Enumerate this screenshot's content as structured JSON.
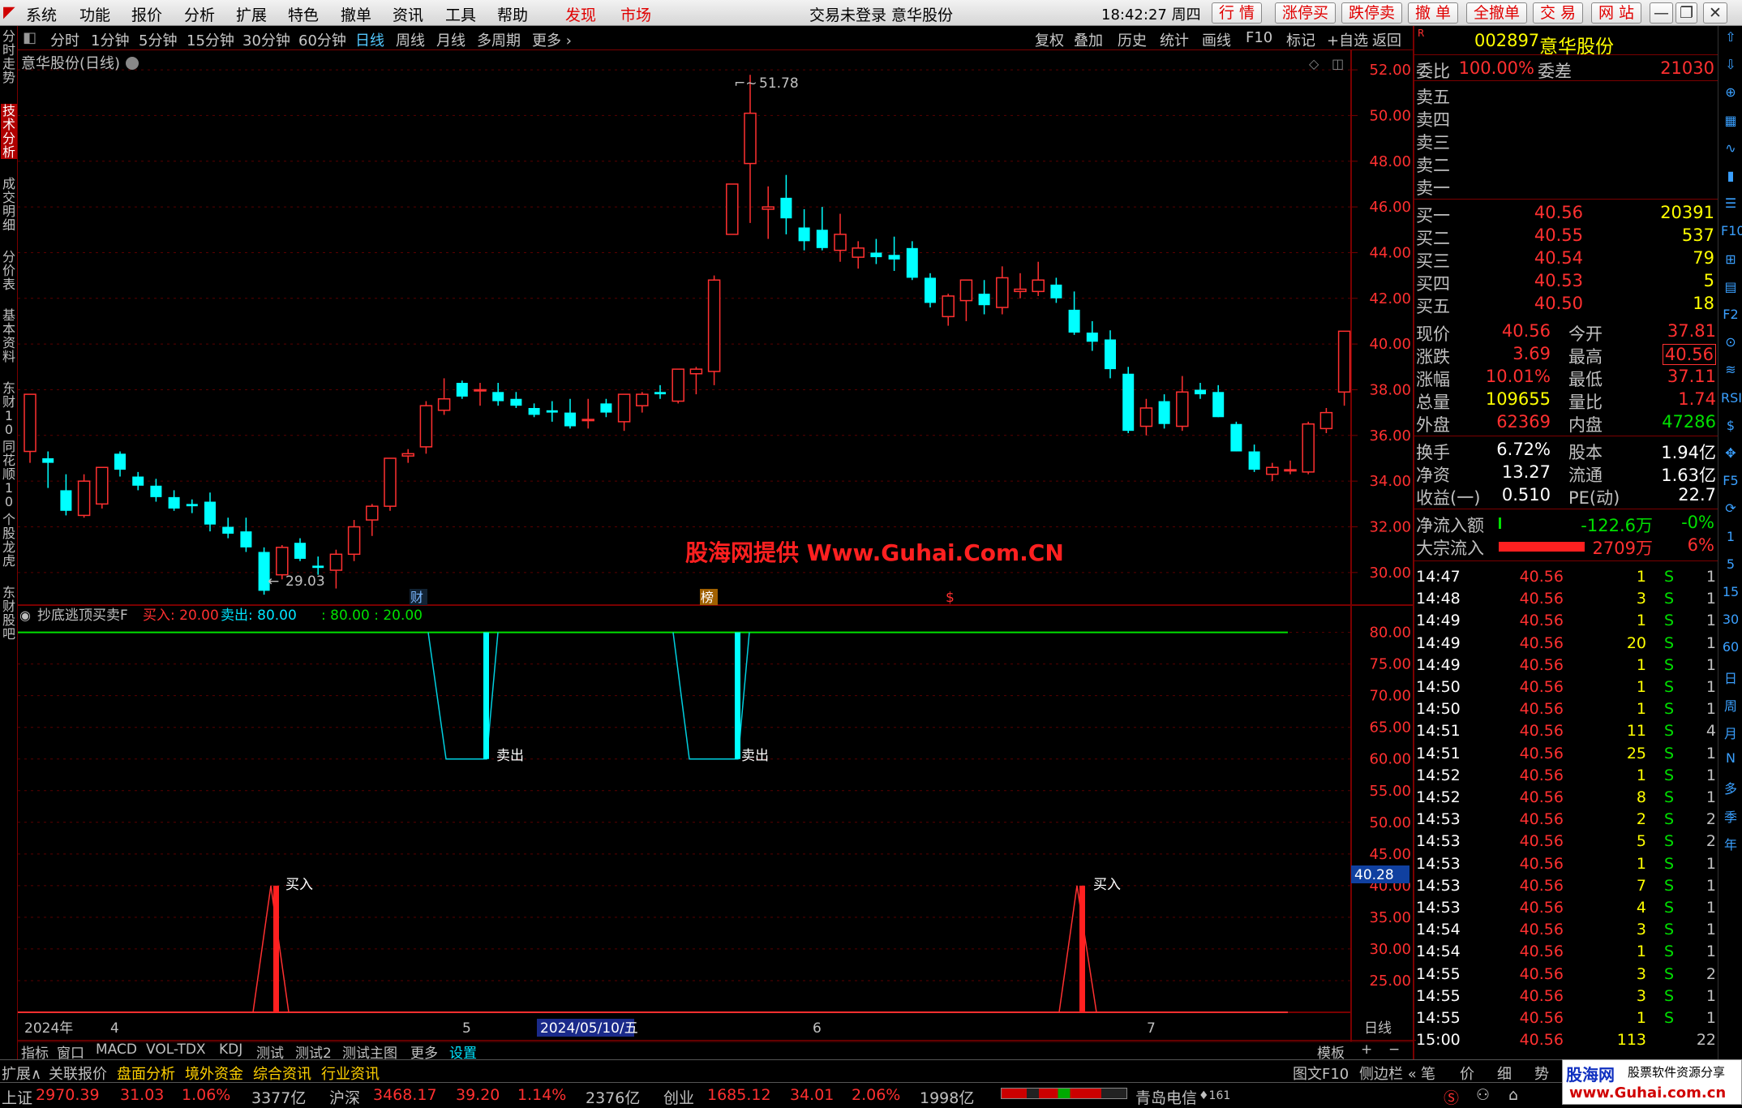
{
  "menubar": {
    "items": [
      "系统",
      "功能",
      "报价",
      "分析",
      "扩展",
      "特色",
      "撤单",
      "资讯",
      "工具",
      "帮助"
    ],
    "hot": [
      "发现",
      "市场"
    ],
    "center_title": "交易未登录  意华股份",
    "time": "18:42:27 周四",
    "right_buttons": [
      "行 情",
      "涨停买",
      "跌停卖",
      "撤 单",
      "全撤单",
      "交 易",
      "网 站"
    ]
  },
  "periodbar": {
    "items": [
      "分时",
      "1分钟",
      "5分钟",
      "15分钟",
      "30分钟",
      "60分钟",
      "日线",
      "周线",
      "月线",
      "多周期",
      "更多 ›"
    ],
    "selected": "日线",
    "tools": [
      "复权",
      "叠加",
      "历史",
      "统计",
      "画线",
      "F10",
      "标记",
      "+自选",
      "返回"
    ]
  },
  "left_rail": [
    "分时走势",
    "技术分析",
    "成交明细",
    "分价表",
    "基本资料",
    "东财10",
    "同花顺10",
    "个股龙虎",
    "东财股吧"
  ],
  "right_rail": [
    "⇧",
    "⇩",
    "⊕",
    "▦",
    "∿",
    "▮",
    "☰",
    "F10",
    "⊞",
    "▤",
    "F2",
    "⊙",
    "≋",
    "RSI",
    "$",
    "✥",
    "F5",
    "⟳",
    "1",
    "5",
    "15",
    "30",
    "60",
    "日",
    "周",
    "月",
    "N",
    "多",
    "季",
    "年"
  ],
  "chart": {
    "title": "意华股份(日线)",
    "high_label": "51.78",
    "low_label": "29.03",
    "event_marks": [
      "财",
      "榜",
      "$"
    ],
    "indicator_name": "抄底逃顶买卖F",
    "indicator_buy": "买入: 20.00",
    "indicator_sell": "卖出: 80.00",
    "indicator_extra": ": 80.00 : 20.00",
    "sell_label": "卖出",
    "buy_label": "买入",
    "cursor_value": "40.28",
    "x_labels": [
      "2024年",
      "4",
      "5",
      "2024/05/10/五",
      "6",
      "7"
    ],
    "x_period": "日线",
    "watermark": "股海网提供 Www.Guhai.Com.CN"
  },
  "chart_data": [
    {
      "type": "candlestick",
      "title": "意华股份(日线)",
      "ylim": [
        29,
        52.5
      ],
      "yticks": [
        "52.00",
        "50.00",
        "48.00",
        "46.00",
        "44.00",
        "42.00",
        "40.00",
        "38.00",
        "36.00",
        "34.00",
        "32.00",
        "30.00"
      ],
      "candles": [
        {
          "o": 35.3,
          "h": 37.5,
          "l": 34.8,
          "c": 37.8
        },
        {
          "o": 35,
          "h": 35.3,
          "l": 33.7,
          "c": 34.8
        },
        {
          "o": 33.6,
          "h": 34.3,
          "l": 32.5,
          "c": 32.7
        },
        {
          "o": 32.5,
          "h": 34.3,
          "l": 32.4,
          "c": 34
        },
        {
          "o": 33,
          "h": 34.6,
          "l": 32.8,
          "c": 34.6
        },
        {
          "o": 35.2,
          "h": 35.3,
          "l": 34.2,
          "c": 34.5
        },
        {
          "o": 34.2,
          "h": 34.4,
          "l": 33.6,
          "c": 33.8
        },
        {
          "o": 33.8,
          "h": 34.1,
          "l": 33.1,
          "c": 33.3
        },
        {
          "o": 33.3,
          "h": 33.6,
          "l": 32.7,
          "c": 32.8
        },
        {
          "o": 33,
          "h": 33.2,
          "l": 32.6,
          "c": 32.9
        },
        {
          "o": 33.1,
          "h": 33.5,
          "l": 31.8,
          "c": 32.1
        },
        {
          "o": 32,
          "h": 32.4,
          "l": 31.5,
          "c": 31.7
        },
        {
          "o": 31.8,
          "h": 32.4,
          "l": 30.9,
          "c": 31.1
        },
        {
          "o": 30.9,
          "h": 31.1,
          "l": 29.03,
          "c": 29.2
        },
        {
          "o": 29.9,
          "h": 31.2,
          "l": 29.7,
          "c": 31.1
        },
        {
          "o": 31.3,
          "h": 31.5,
          "l": 30.5,
          "c": 30.6
        },
        {
          "o": 30.3,
          "h": 30.7,
          "l": 29.9,
          "c": 30.2
        },
        {
          "o": 30.1,
          "h": 31,
          "l": 29.3,
          "c": 30.8
        },
        {
          "o": 30.8,
          "h": 32.3,
          "l": 30.5,
          "c": 32
        },
        {
          "o": 32.3,
          "h": 33,
          "l": 31.6,
          "c": 32.9
        },
        {
          "o": 32.9,
          "h": 35,
          "l": 32.7,
          "c": 35
        },
        {
          "o": 35.1,
          "h": 35.4,
          "l": 34.8,
          "c": 35.2
        },
        {
          "o": 35.5,
          "h": 37.5,
          "l": 35.2,
          "c": 37.3
        },
        {
          "o": 37.1,
          "h": 38.5,
          "l": 36.9,
          "c": 37.6
        },
        {
          "o": 38.3,
          "h": 38.4,
          "l": 37.6,
          "c": 37.7
        },
        {
          "o": 38,
          "h": 38.3,
          "l": 37.3,
          "c": 38
        },
        {
          "o": 37.9,
          "h": 38.3,
          "l": 37.3,
          "c": 37.5
        },
        {
          "o": 37.6,
          "h": 37.9,
          "l": 37.2,
          "c": 37.3
        },
        {
          "o": 37.2,
          "h": 37.4,
          "l": 36.8,
          "c": 36.9
        },
        {
          "o": 37.1,
          "h": 37.5,
          "l": 36.6,
          "c": 37
        },
        {
          "o": 37,
          "h": 37.6,
          "l": 36.3,
          "c": 36.4
        },
        {
          "o": 36.7,
          "h": 37.6,
          "l": 36.3,
          "c": 36.7
        },
        {
          "o": 37.4,
          "h": 37.6,
          "l": 36.8,
          "c": 37
        },
        {
          "o": 36.6,
          "h": 37.8,
          "l": 36.2,
          "c": 37.8
        },
        {
          "o": 37.3,
          "h": 37.9,
          "l": 37,
          "c": 37.8
        },
        {
          "o": 37.9,
          "h": 38.2,
          "l": 37.6,
          "c": 37.8
        },
        {
          "o": 37.5,
          "h": 38.4,
          "l": 37.4,
          "c": 38.9
        },
        {
          "o": 38.7,
          "h": 39,
          "l": 37.8,
          "c": 38.9
        },
        {
          "o": 38.8,
          "h": 43,
          "l": 38.2,
          "c": 42.8
        },
        {
          "o": 44.8,
          "h": 47,
          "l": 44.8,
          "c": 47
        },
        {
          "o": 47.9,
          "h": 51.78,
          "l": 45.3,
          "c": 50.1
        },
        {
          "o": 45.9,
          "h": 46.9,
          "l": 44.6,
          "c": 46
        },
        {
          "o": 46.4,
          "h": 47.4,
          "l": 44.8,
          "c": 45.5
        },
        {
          "o": 45.1,
          "h": 45.9,
          "l": 44.1,
          "c": 44.5
        },
        {
          "o": 45,
          "h": 46,
          "l": 44.1,
          "c": 44.2
        },
        {
          "o": 44.1,
          "h": 45.7,
          "l": 43.6,
          "c": 44.8
        },
        {
          "o": 43.8,
          "h": 44.5,
          "l": 43.3,
          "c": 44.2
        },
        {
          "o": 44,
          "h": 44.6,
          "l": 43.5,
          "c": 43.8
        },
        {
          "o": 43.9,
          "h": 44.7,
          "l": 43.2,
          "c": 43.7
        },
        {
          "o": 44.2,
          "h": 44.5,
          "l": 42.8,
          "c": 42.9
        },
        {
          "o": 42.9,
          "h": 43.1,
          "l": 41.6,
          "c": 41.8
        },
        {
          "o": 41.2,
          "h": 42.2,
          "l": 40.8,
          "c": 42.1
        },
        {
          "o": 41.9,
          "h": 42.6,
          "l": 41,
          "c": 42.8
        },
        {
          "o": 42.2,
          "h": 42.8,
          "l": 41.3,
          "c": 41.7
        },
        {
          "o": 41.6,
          "h": 43.4,
          "l": 41.3,
          "c": 42.9
        },
        {
          "o": 42.3,
          "h": 43.1,
          "l": 42,
          "c": 42.4
        },
        {
          "o": 42.3,
          "h": 43.6,
          "l": 42.1,
          "c": 42.8
        },
        {
          "o": 42.6,
          "h": 42.9,
          "l": 41.8,
          "c": 42
        },
        {
          "o": 41.5,
          "h": 42.3,
          "l": 40.4,
          "c": 40.5
        },
        {
          "o": 40.5,
          "h": 41,
          "l": 39.7,
          "c": 40.1
        },
        {
          "o": 40.2,
          "h": 40.6,
          "l": 38.5,
          "c": 38.9
        },
        {
          "o": 38.7,
          "h": 39,
          "l": 36.1,
          "c": 36.2
        },
        {
          "o": 36.4,
          "h": 37.6,
          "l": 36,
          "c": 37.2
        },
        {
          "o": 37.5,
          "h": 37.8,
          "l": 36.3,
          "c": 36.5
        },
        {
          "o": 36.4,
          "h": 38.6,
          "l": 36.2,
          "c": 37.9
        },
        {
          "o": 38,
          "h": 38.3,
          "l": 37.6,
          "c": 37.8
        },
        {
          "o": 37.9,
          "h": 38.2,
          "l": 36.8,
          "c": 36.8
        },
        {
          "o": 36.5,
          "h": 36.6,
          "l": 35.3,
          "c": 35.3
        },
        {
          "o": 35.3,
          "h": 35.6,
          "l": 34.4,
          "c": 34.5
        },
        {
          "o": 34.3,
          "h": 34.8,
          "l": 34,
          "c": 34.6
        },
        {
          "o": 34.5,
          "h": 34.9,
          "l": 34.3,
          "c": 34.5
        },
        {
          "o": 34.4,
          "h": 36.6,
          "l": 34.3,
          "c": 36.5
        },
        {
          "o": 36.3,
          "h": 37.2,
          "l": 36.1,
          "c": 37
        },
        {
          "o": 37.9,
          "h": 40.56,
          "l": 37.3,
          "c": 40.56
        }
      ]
    },
    {
      "type": "line",
      "title": "抄底逃顶买卖F",
      "ylim": [
        20,
        82
      ],
      "yticks": [
        "80.00",
        "75.00",
        "70.00",
        "65.00",
        "60.00",
        "55.00",
        "50.00",
        "45.00",
        "40.00",
        "35.00",
        "30.00",
        "25.00"
      ],
      "series": [
        {
          "name": "买入",
          "value": 20.0
        },
        {
          "name": "卖出",
          "value": 80.0
        }
      ]
    }
  ],
  "quote": {
    "code": "002897",
    "name": "意华股份",
    "weibi_label": "委比",
    "weibi": "100.00%",
    "weicha_label": "委差",
    "weicha": "21030",
    "sell": [
      {
        "label": "卖五"
      },
      {
        "label": "卖四"
      },
      {
        "label": "卖三"
      },
      {
        "label": "卖二"
      },
      {
        "label": "卖一"
      }
    ],
    "buy": [
      {
        "label": "买一",
        "price": "40.56",
        "vol": "20391"
      },
      {
        "label": "买二",
        "price": "40.55",
        "vol": "537"
      },
      {
        "label": "买三",
        "price": "40.54",
        "vol": "79"
      },
      {
        "label": "买四",
        "price": "40.53",
        "vol": "5"
      },
      {
        "label": "买五",
        "price": "40.50",
        "vol": "18"
      }
    ],
    "stats": [
      {
        "l1": "现价",
        "v1": "40.56",
        "l2": "今开",
        "v2": "37.81"
      },
      {
        "l1": "涨跌",
        "v1": "3.69",
        "l2": "最高",
        "v2": "40.56"
      },
      {
        "l1": "涨幅",
        "v1": "10.01%",
        "l2": "最低",
        "v2": "37.11"
      },
      {
        "l1": "总量",
        "v1": "109655",
        "l2": "量比",
        "v2": "1.74"
      },
      {
        "l1": "外盘",
        "v1": "62369",
        "l2": "内盘",
        "v2": "47286"
      }
    ],
    "stats2": [
      {
        "l1": "换手",
        "v1": "6.72%",
        "l2": "股本",
        "v2": "1.94亿"
      },
      {
        "l1": "净资",
        "v1": "13.27",
        "l2": "流通",
        "v2": "1.63亿"
      },
      {
        "l1": "收益(一)",
        "v1": "0.510",
        "l2": "PE(动)",
        "v2": "22.7"
      }
    ],
    "netflow_label": "净流入额",
    "netflow": "-122.6万",
    "netflow_pct": "-0%",
    "bigflow_label": "大宗流入",
    "bigflow": "2709万",
    "bigflow_pct": "6%",
    "ticks": [
      [
        "14:47",
        "40.56",
        "1",
        "S",
        "1"
      ],
      [
        "14:48",
        "40.56",
        "3",
        "S",
        "1"
      ],
      [
        "14:49",
        "40.56",
        "1",
        "S",
        "1"
      ],
      [
        "14:49",
        "40.56",
        "20",
        "S",
        "1"
      ],
      [
        "14:49",
        "40.56",
        "1",
        "S",
        "1"
      ],
      [
        "14:50",
        "40.56",
        "1",
        "S",
        "1"
      ],
      [
        "14:50",
        "40.56",
        "1",
        "S",
        "1"
      ],
      [
        "14:51",
        "40.56",
        "11",
        "S",
        "4"
      ],
      [
        "14:51",
        "40.56",
        "25",
        "S",
        "1"
      ],
      [
        "14:52",
        "40.56",
        "1",
        "S",
        "1"
      ],
      [
        "14:52",
        "40.56",
        "8",
        "S",
        "1"
      ],
      [
        "14:53",
        "40.56",
        "2",
        "S",
        "2"
      ],
      [
        "14:53",
        "40.56",
        "5",
        "S",
        "2"
      ],
      [
        "14:53",
        "40.56",
        "1",
        "S",
        "1"
      ],
      [
        "14:53",
        "40.56",
        "7",
        "S",
        "1"
      ],
      [
        "14:53",
        "40.56",
        "4",
        "S",
        "1"
      ],
      [
        "14:54",
        "40.56",
        "3",
        "S",
        "1"
      ],
      [
        "14:54",
        "40.56",
        "1",
        "S",
        "1"
      ],
      [
        "14:55",
        "40.56",
        "3",
        "S",
        "2"
      ],
      [
        "14:55",
        "40.56",
        "3",
        "S",
        "1"
      ],
      [
        "14:55",
        "40.56",
        "1",
        "S",
        "1"
      ],
      [
        "15:00",
        "40.56",
        "113",
        "",
        "22"
      ]
    ],
    "bottom_tabs": [
      "笔",
      "价",
      "细",
      "势"
    ]
  },
  "bottom_tabs": [
    "指标",
    "窗口",
    "MACD",
    "VOL-TDX",
    "KDJ",
    "测试",
    "测试2",
    "测试主图",
    "更多",
    "设置"
  ],
  "bottom_tabs_right": [
    "模板",
    "+",
    "−"
  ],
  "row2": [
    "扩展∧",
    "关联报价",
    "盘面分析",
    "境外资金",
    "综合资讯",
    "行业资讯"
  ],
  "row2_right": [
    "图文F10",
    "侧边栏 «"
  ],
  "status": {
    "sh_label": "上证",
    "sh": "2970.39",
    "sh_chg": "31.03",
    "sh_pct": "1.06%",
    "sh_amt": "3377亿",
    "hs_label": "沪深",
    "hs": "3468.17",
    "hs_chg": "39.20",
    "hs_pct": "1.14%",
    "hs_amt": "2376亿",
    "cy_label": "创业",
    "cy": "1685.12",
    "cy_chg": "34.01",
    "cy_pct": "2.06%",
    "cy_amt": "1998亿",
    "server": "青岛电信",
    "server_no": "♦161"
  },
  "logo": {
    "brand": "股海网",
    "tag": "股票软件资源分享",
    "url": "www.Guhai.com.cn"
  }
}
